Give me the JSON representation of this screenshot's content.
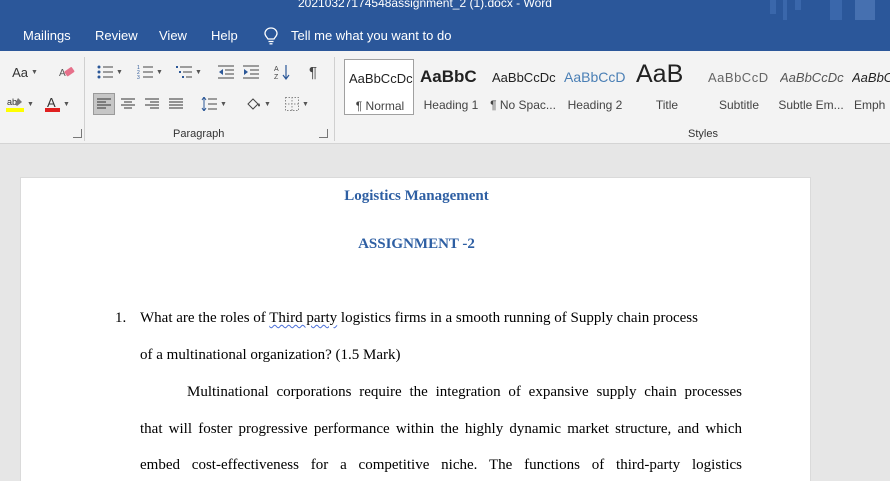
{
  "window": {
    "title": "20210327174548assignment_2 (1).docx  -  Word",
    "accent_color": "#2b579a"
  },
  "menu": {
    "tabs": [
      "Mailings",
      "Review",
      "View",
      "Help"
    ],
    "tell_me": "Tell me what you want to do"
  },
  "ribbon": {
    "font_group": {
      "change_case_label": "Aa",
      "clear_formatting_icon": "eraser-icon",
      "highlight_icon": "text-highlight-icon",
      "highlight_color": "#ffff00",
      "font_color_icon": "font-color-icon",
      "font_color": "#e02020"
    },
    "paragraph_group": {
      "label": "Paragraph",
      "buttons": [
        "bullets",
        "numbering",
        "multilevel-list",
        "decrease-indent",
        "increase-indent",
        "sort",
        "show-marks",
        "align-left",
        "center",
        "align-right",
        "justify",
        "line-spacing",
        "shading",
        "borders"
      ],
      "active_alignment": "align-left"
    },
    "styles_group": {
      "label": "Styles",
      "items": [
        {
          "sample": "AaBbCcDc",
          "name": "¶ Normal",
          "selected": true
        },
        {
          "sample": "AaBbC",
          "name": "Heading 1"
        },
        {
          "sample": "AaBbCcDc",
          "name": "¶ No Spac..."
        },
        {
          "sample": "AaBbCcD",
          "name": "Heading 2"
        },
        {
          "sample": "AaB",
          "name": "Title"
        },
        {
          "sample": "AaBbCcD",
          "name": "Subtitle"
        },
        {
          "sample": "AaBbCcDc",
          "name": "Subtle Em..."
        },
        {
          "sample": "AaBbC",
          "name": "Emph"
        }
      ]
    }
  },
  "document": {
    "title": "Logistics Management",
    "subtitle": "ASSIGNMENT -2",
    "heading_color": "#2e5fa3",
    "question_number": "1.",
    "question_line1_a": "What are the roles of ",
    "question_line1_misspelled": "Third party",
    "question_line1_b": " logistics firms in a smooth running of Supply chain process",
    "question_line2": "of a multinational organization? (1.5 Mark)",
    "answer_lines": [
      "Multinational corporations require the integration of expansive supply chain processes",
      "that will foster progressive performance within the highly dynamic market structure, and which",
      "embed cost-effectiveness for a competitive niche. The functions of third-party logistics"
    ]
  }
}
